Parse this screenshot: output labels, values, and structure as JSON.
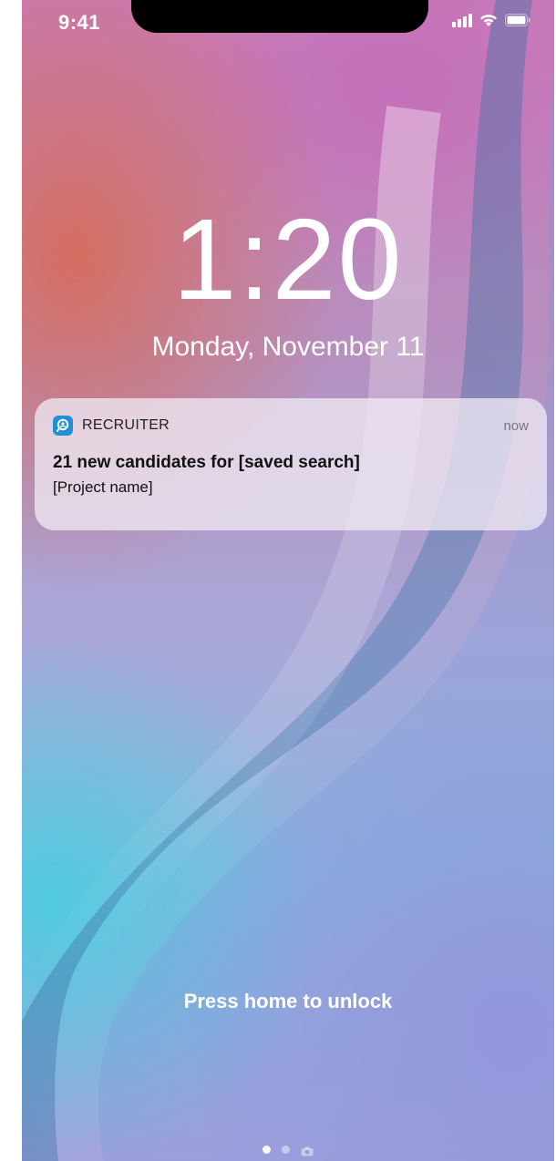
{
  "status_bar": {
    "time": "9:41",
    "icons": [
      "signal-icon",
      "wifi-icon",
      "battery-icon"
    ]
  },
  "lock_screen": {
    "time": "1:20",
    "date": "Monday, November 11"
  },
  "notification": {
    "app_icon": "recruiter-search-icon",
    "app_name": "RECRUITER",
    "timestamp": "now",
    "title": "21 new candidates for [saved search]",
    "body": "[Project name]"
  },
  "unlock_prompt": "Press home to unlock",
  "page_indicator": {
    "active_index": 0,
    "icons": [
      "dot",
      "dot",
      "camera-icon"
    ]
  },
  "colors": {
    "accent": "#1f8fd6",
    "text_primary": "#111111",
    "text_secondary": "#7a7482"
  }
}
